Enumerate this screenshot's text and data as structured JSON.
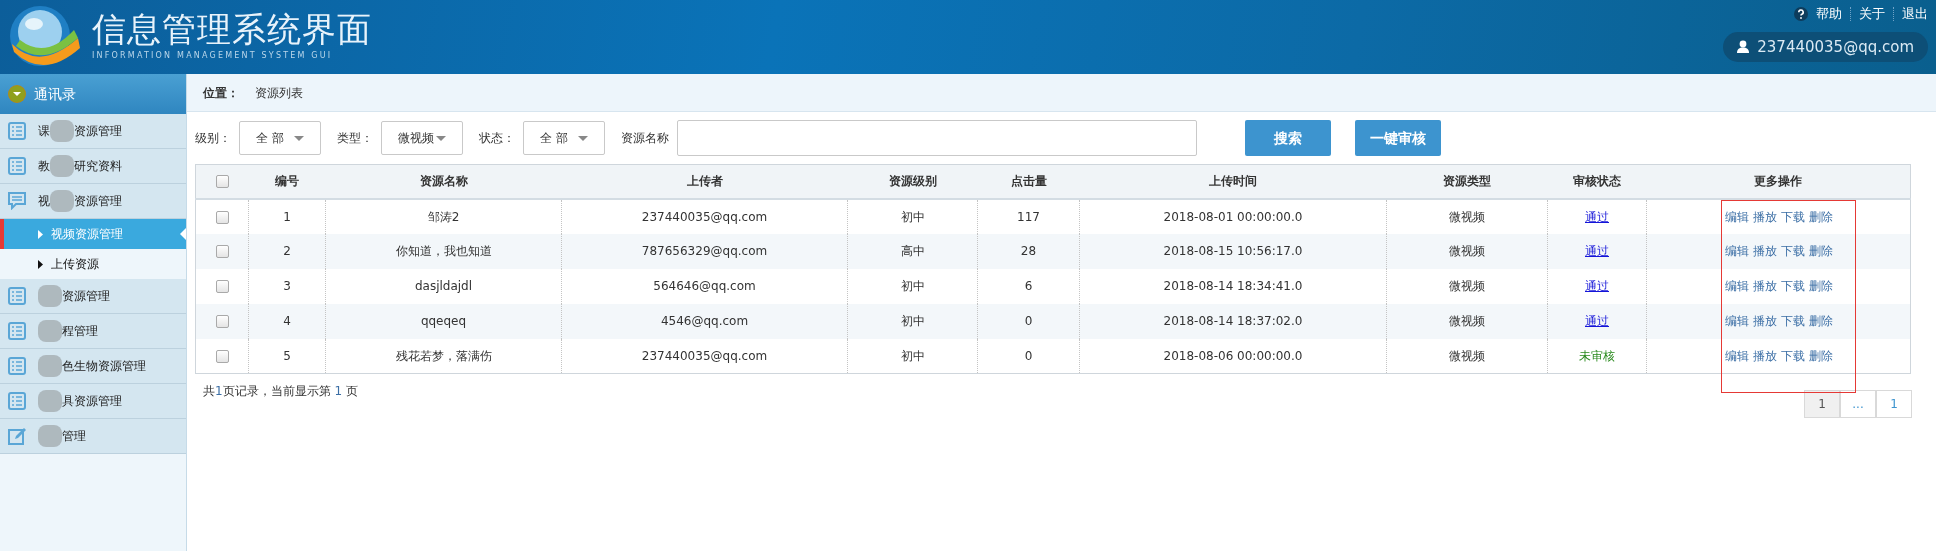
{
  "header": {
    "title": "信息管理系统界面",
    "subtitle": "INFORMATION MANAGEMENT SYSTEM GUI",
    "links": [
      "帮助",
      "关于",
      "退出"
    ],
    "user": "237440035@qq.com"
  },
  "sidebar": {
    "heading": "通讯录",
    "items": [
      {
        "kind": "list",
        "prefix": "课",
        "text": "资源管理"
      },
      {
        "kind": "list",
        "prefix": "教",
        "text": "研究资料"
      },
      {
        "kind": "chat",
        "prefix": "视",
        "text": "资源管理",
        "children": [
          {
            "text": "视频资源管理",
            "selected": true
          },
          {
            "text": "上传资源",
            "selected": false
          }
        ]
      },
      {
        "kind": "list",
        "text": "资源管理"
      },
      {
        "kind": "list",
        "text": "程管理"
      },
      {
        "kind": "list",
        "text": "色生物资源管理"
      },
      {
        "kind": "list",
        "text": "具资源管理"
      },
      {
        "kind": "edit",
        "text": "管理"
      }
    ]
  },
  "breadcrumb": {
    "label": "位置：",
    "current": "资源列表"
  },
  "filters": [
    {
      "label": "级别：",
      "value": "全 部"
    },
    {
      "label": "类型：",
      "value": "微视频"
    },
    {
      "label": "状态：",
      "value": "全 部"
    }
  ],
  "search": {
    "label": "资源名称"
  },
  "buttons": [
    "搜索",
    "一键审核"
  ],
  "table": {
    "columns": [
      "编号",
      "资源名称",
      "上传者",
      "资源级别",
      "点击量",
      "上传时间",
      "资源类型",
      "审核状态",
      "更多操作"
    ],
    "rows": [
      {
        "checked": false,
        "cells": [
          "1",
          "邹涛2",
          "237440035@qq.com",
          "初中",
          "117",
          "2018-08-01 00:00:00.0",
          "微视频"
        ],
        "status": "通过",
        "kind": "approved",
        "actions": [
          "编辑",
          "播放",
          "下载",
          "删除"
        ]
      },
      {
        "checked": false,
        "cells": [
          "2",
          "你知道，我也知道",
          "787656329@qq.com",
          "高中",
          "28",
          "2018-08-15 10:56:17.0",
          "微视频"
        ],
        "status": "通过",
        "kind": "approved",
        "actions": [
          "编辑",
          "播放",
          "下载",
          "删除"
        ]
      },
      {
        "checked": false,
        "cells": [
          "3",
          "dasjldajdl",
          "564646@qq.com",
          "初中",
          "6",
          "2018-08-14 18:34:41.0",
          "微视频"
        ],
        "status": "通过",
        "kind": "approved",
        "actions": [
          "编辑",
          "播放",
          "下载",
          "删除"
        ]
      },
      {
        "checked": false,
        "cells": [
          "4",
          "qqeqeq",
          "4546@qq.com",
          "初中",
          "0",
          "2018-08-14 18:37:02.0",
          "微视频"
        ],
        "status": "通过",
        "kind": "approved",
        "actions": [
          "编辑",
          "播放",
          "下载",
          "删除"
        ]
      },
      {
        "checked": false,
        "cells": [
          "5",
          "残花若梦，落满伤",
          "237440035@qq.com",
          "初中",
          "0",
          "2018-08-06 00:00:00.0",
          "微视频"
        ],
        "status": "未审核",
        "kind": "pending",
        "actions": [
          "编辑",
          "播放",
          "下载",
          "删除"
        ]
      }
    ],
    "select_all": false
  },
  "summary": {
    "before": "共",
    "pages": "1",
    "middle": "页记录，当前显示第 ",
    "current": "1",
    "after": " 页"
  },
  "pagination": [
    {
      "label": "1",
      "selected": true
    },
    {
      "label": "...",
      "selected": false
    },
    {
      "label": "1",
      "selected": false
    }
  ]
}
